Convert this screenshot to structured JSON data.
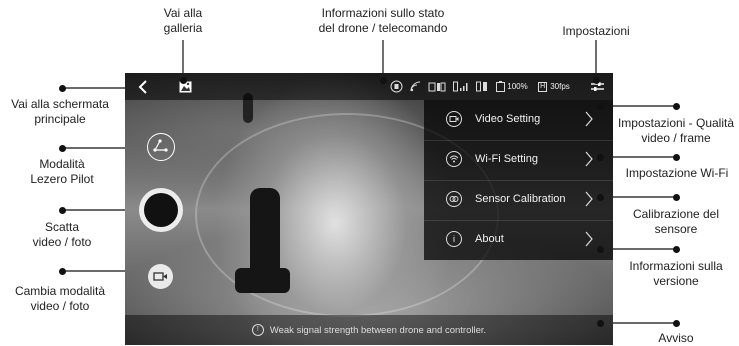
{
  "labels": {
    "gallery": [
      "Vai alla",
      "galleria"
    ],
    "status": [
      "Informazioni sullo stato",
      "del drone / telecomando"
    ],
    "settings": "Impostazioni",
    "home": [
      "Vai alla schermata",
      "principale"
    ],
    "pilot_mode": [
      "Modalità",
      "Lezero Pilot"
    ],
    "capture": [
      "Scatta",
      "video / foto"
    ],
    "switch_mode": [
      "Cambia modalità",
      "video / foto"
    ],
    "video_quality": [
      "Impostazioni - Qualità",
      "video / frame"
    ],
    "wifi": "Impostazione Wi-Fi",
    "calibration": [
      "Calibrazione del",
      "sensore"
    ],
    "version": [
      "Informazioni sulla",
      "versione"
    ],
    "warning": "Avviso"
  },
  "topbar": {
    "battery": "100%",
    "fps": "30fps",
    "resolution_badge": "H"
  },
  "menu": {
    "items": [
      {
        "label": "Video Setting",
        "icon": "video-icon"
      },
      {
        "label": "Wi-Fi Setting",
        "icon": "wifi-icon"
      },
      {
        "label": "Sensor Calibration",
        "icon": "sensor-icon"
      },
      {
        "label": "About",
        "icon": "info-icon"
      }
    ]
  },
  "warning_text": "Weak signal strength between drone and controller."
}
